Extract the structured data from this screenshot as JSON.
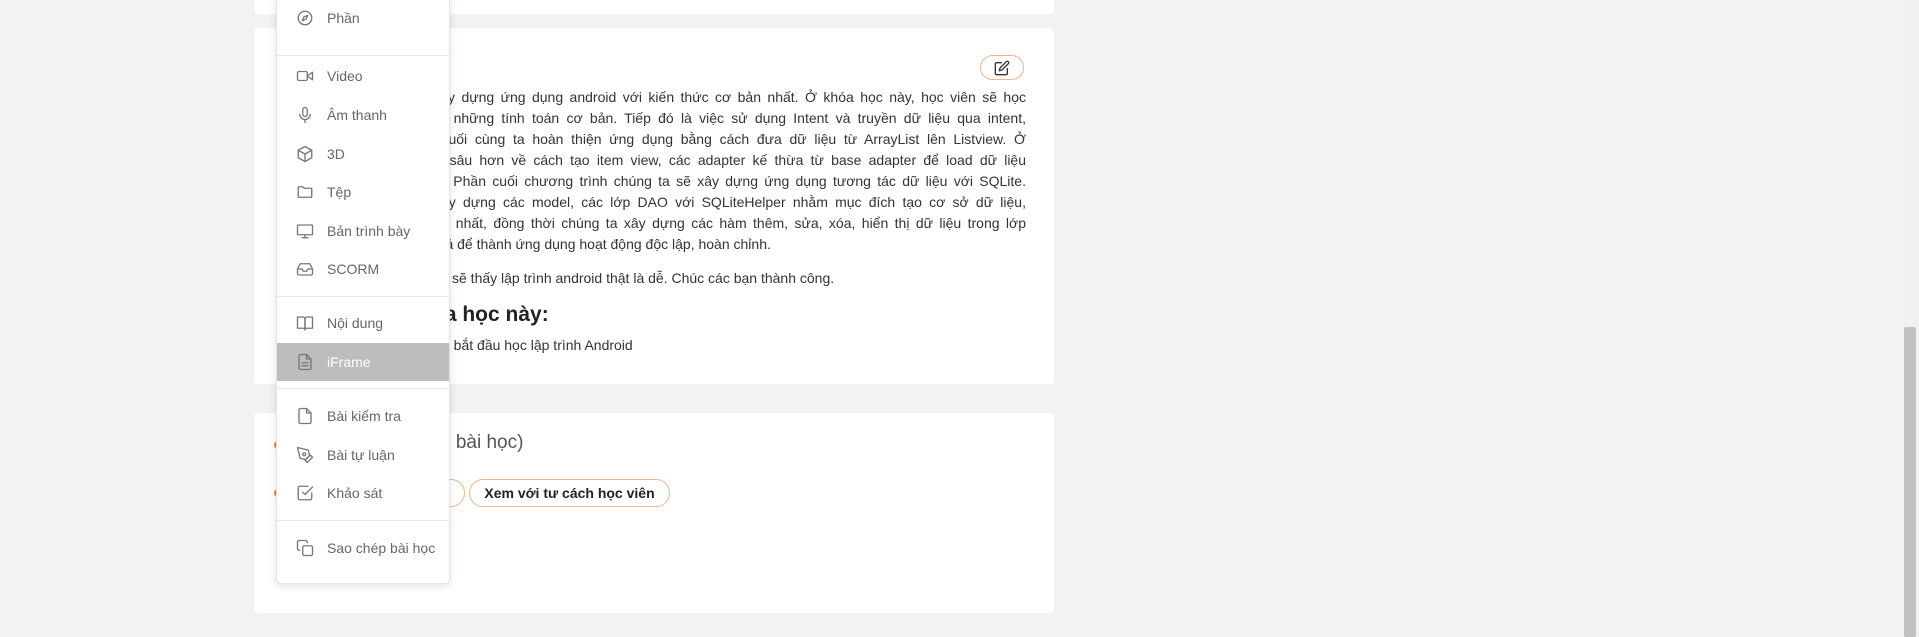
{
  "description": {
    "lines": [
      "ệc xây dựng ứng dụng android với kiến thức cơ bản nhất. Ở khóa học này, học viên sẽ học",
      "d với những tính toán cơ bản. Tiếp đó là việc sử dụng Intent và truyền dữ liệu qua intent,",
      "ác. Cuối cùng ta hoàn thiện ứng dụng bằng cách đưa dữ liệu từ ArrayList lên Listview. Ở",
      "uyên sâu hơn về cách tạo item view, các adapter kế thừa từ base adapter để load dữ liệu",
      "droid. Phần cuối chương trình chúng ta sẽ xây dựng ứng dụng tương tác dữ liệu với SQLite.",
      "ch xây dựng các model, các lớp DAO với SQLiteHelper nhằm mục đích tạo cơ sở dữ liệu,",
      "ận lợi nhất, đồng thời chúng ta xây dựng các hàm thêm, sửa, xóa, hiển thị dữ liệu trong lớp",
      "i tất cả để thành ứng dụng hoạt động độc lập, hoàn chỉnh."
    ],
    "paragraph2": "sẽ thấy lập trình android thật là dễ. Chúc các bạn thành công.",
    "heading": "óa học này:",
    "bullet": "n bắt đầu học lập trình Android"
  },
  "lessons": {
    "title": "2 bài học)",
    "student_view_label": "Xem với tư cách học viên"
  },
  "menu": {
    "items": [
      {
        "label": "Phần",
        "icon": "compass-icon"
      },
      {
        "label": "Video",
        "icon": "video-camera-icon"
      },
      {
        "label": "Âm thanh",
        "icon": "microphone-icon"
      },
      {
        "label": "3D",
        "icon": "cube-icon"
      },
      {
        "label": "Tệp",
        "icon": "folder-icon"
      },
      {
        "label": "Bản trình bày",
        "icon": "monitor-icon"
      },
      {
        "label": "SCORM",
        "icon": "inbox-icon"
      },
      {
        "label": "Nội dung",
        "icon": "book-icon"
      },
      {
        "label": "iFrame",
        "icon": "document-icon"
      },
      {
        "label": "Bài kiểm tra",
        "icon": "file-icon"
      },
      {
        "label": "Bài tự luận",
        "icon": "pen-icon"
      },
      {
        "label": "Khảo sát",
        "icon": "checkbox-icon"
      },
      {
        "label": "Sao chép bài học",
        "icon": "copy-icon"
      }
    ],
    "active_item": "iFrame"
  },
  "colors": {
    "accent": "#f27a3b",
    "pill_border": "#f1b48c",
    "menu_active_bg": "#bdbdbd"
  }
}
